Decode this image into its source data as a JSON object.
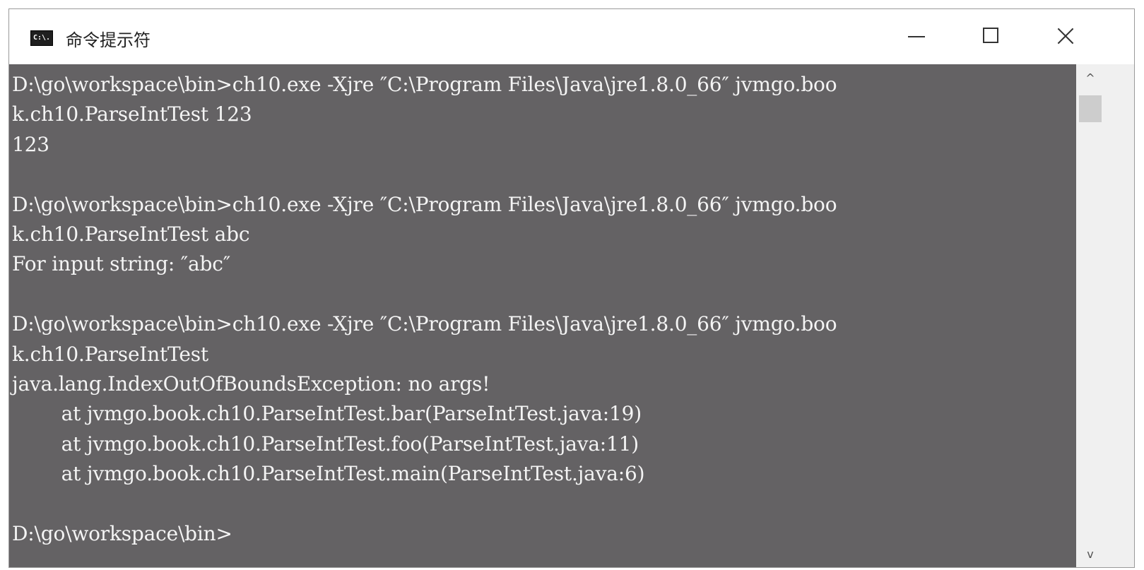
{
  "window": {
    "title": "命令提示符",
    "icon": "cmd-icon",
    "icon_label": "C:\\."
  },
  "controls": {
    "minimize": "minimize-icon",
    "maximize": "maximize-icon",
    "close": "close-icon"
  },
  "console": {
    "lines": [
      "D:\\go\\workspace\\bin>ch10.exe -Xjre ″C:\\Program Files\\Java\\jre1.8.0_66″ jvmgo.boo",
      "k.ch10.ParseIntTest 123",
      "123",
      "",
      "D:\\go\\workspace\\bin>ch10.exe -Xjre ″C:\\Program Files\\Java\\jre1.8.0_66″ jvmgo.boo",
      "k.ch10.ParseIntTest abc",
      "For input string: ″abc″",
      "",
      "D:\\go\\workspace\\bin>ch10.exe -Xjre ″C:\\Program Files\\Java\\jre1.8.0_66″ jvmgo.boo",
      "k.ch10.ParseIntTest",
      "java.lang.IndexOutOfBoundsException: no args!",
      "        at jvmgo.book.ch10.ParseIntTest.bar(ParseIntTest.java:19)",
      "        at jvmgo.book.ch10.ParseIntTest.foo(ParseIntTest.java:11)",
      "        at jvmgo.book.ch10.ParseIntTest.main(ParseIntTest.java:6)",
      "",
      "D:\\go\\workspace\\bin>"
    ]
  },
  "colors": {
    "console_bg": "#646264",
    "console_text": "#f4f4f4"
  }
}
